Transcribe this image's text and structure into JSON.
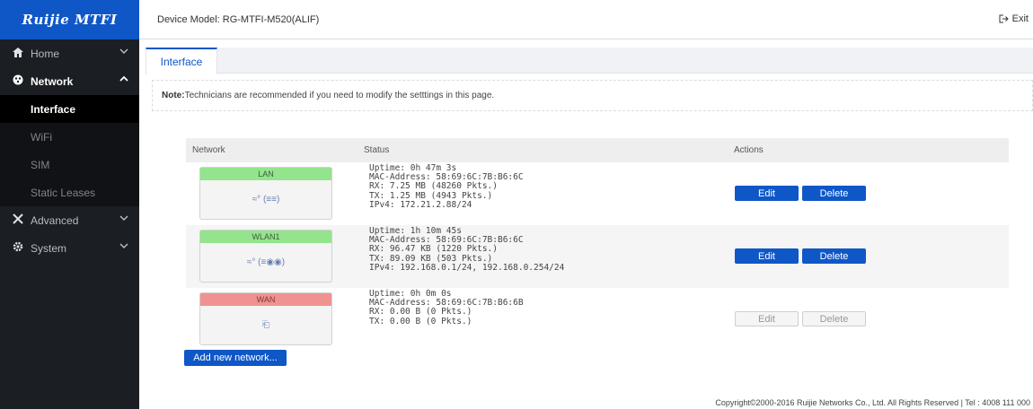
{
  "brand": {
    "logo_text": "Ruijie MTFI"
  },
  "header": {
    "device_model": "Device Model: RG-MTFI-M520(ALIF)",
    "exit_label": "Exit"
  },
  "sidebar": {
    "home": "Home",
    "network": "Network",
    "network_items": [
      "Interface",
      "WiFi",
      "SIM",
      "Static Leases"
    ],
    "advanced": "Advanced",
    "system": "System"
  },
  "tabs": {
    "interface": "Interface"
  },
  "note": {
    "prefix": "Note:",
    "text": "Technicians are recommended if you need to modify the setttings in this page."
  },
  "table": {
    "headers": {
      "network": "Network",
      "status": "Status",
      "actions": "Actions"
    },
    "rows": [
      {
        "name": "LAN",
        "state": "up",
        "icon_text": "≈° (≡≡)",
        "status": [
          "Uptime: 0h 47m 3s",
          "MAC-Address: 58:69:6C:7B:B6:6C",
          "RX: 7.25 MB (48260 Pkts.)",
          "TX: 1.25 MB (4943 Pkts.)",
          "IPv4: 172.21.2.88/24"
        ],
        "edit": "Edit",
        "delete": "Delete",
        "enabled": true
      },
      {
        "name": "WLAN1",
        "state": "up",
        "icon_text": "≈° (≡◉◉)",
        "status": [
          "Uptime: 1h 10m 45s",
          "MAC-Address: 58:69:6C:7B:B6:6C",
          "RX: 96.47 KB (1220 Pkts.)",
          "TX: 89.09 KB (503 Pkts.)",
          "IPv4: 192.168.0.1/24, 192.168.0.254/24"
        ],
        "edit": "Edit",
        "delete": "Delete",
        "enabled": true
      },
      {
        "name": "WAN",
        "state": "down",
        "icon_text": "⎗",
        "status": [
          "Uptime: 0h 0m 0s",
          "MAC-Address: 58:69:6C:7B:B6:6B",
          "RX: 0.00 B (0 Pkts.)",
          "TX: 0.00 B (0 Pkts.)"
        ],
        "edit": "Edit",
        "delete": "Delete",
        "enabled": false
      }
    ]
  },
  "add_network_label": "Add new network...",
  "footer": "Copyright©2000-2016 Ruijie Networks Co., Ltd. All Rights Reserved  |  Tel : 4008 111 000",
  "colors": {
    "brand_blue": "#0f57c7",
    "iface_up": "#93e48c",
    "iface_down": "#f0928f",
    "sidebar_bg": "#1b1e23"
  }
}
